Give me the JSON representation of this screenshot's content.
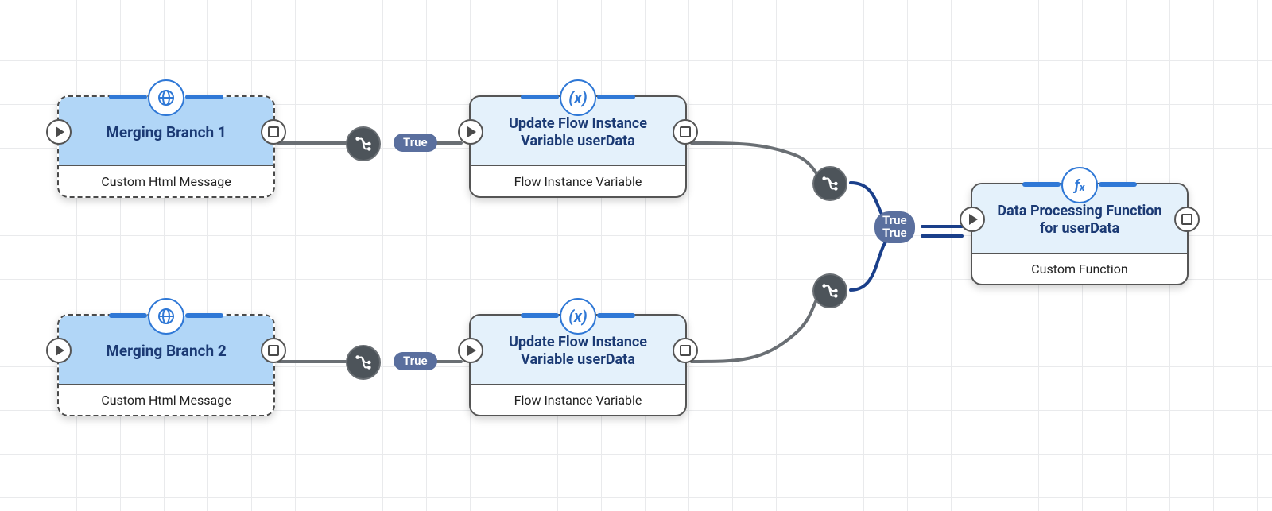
{
  "nodes": {
    "branch1": {
      "title": "Merging Branch 1",
      "subtitle": "Custom Html Message",
      "icon": "globe"
    },
    "branch2": {
      "title": "Merging Branch 2",
      "subtitle": "Custom Html Message",
      "icon": "globe"
    },
    "update1": {
      "title": "Update Flow Instance Variable userData",
      "subtitle": "Flow Instance Variable",
      "icon": "var"
    },
    "update2": {
      "title": "Update Flow Instance Variable userData",
      "subtitle": "Flow Instance Variable",
      "icon": "var"
    },
    "proc": {
      "title": "Data Processing Function for userData",
      "subtitle": "Custom Function",
      "icon": "fx"
    }
  },
  "edgeLabels": {
    "branch1_out": "True",
    "branch2_out": "True",
    "merge_top": "True",
    "merge_bot": "True"
  },
  "icons": {
    "globe": "globe-icon",
    "var": "variable-x-icon",
    "fx": "fx-function-icon",
    "router": "branch-router-icon",
    "play": "play-triangle-icon",
    "stop": "square-stop-icon"
  },
  "colors": {
    "accent": "#2f78d6",
    "nodeHeaderSelected": "#b1d6f7",
    "nodeHeader": "#e4f1fb",
    "pill": "#5a6f9e",
    "router": "#4d545a"
  }
}
